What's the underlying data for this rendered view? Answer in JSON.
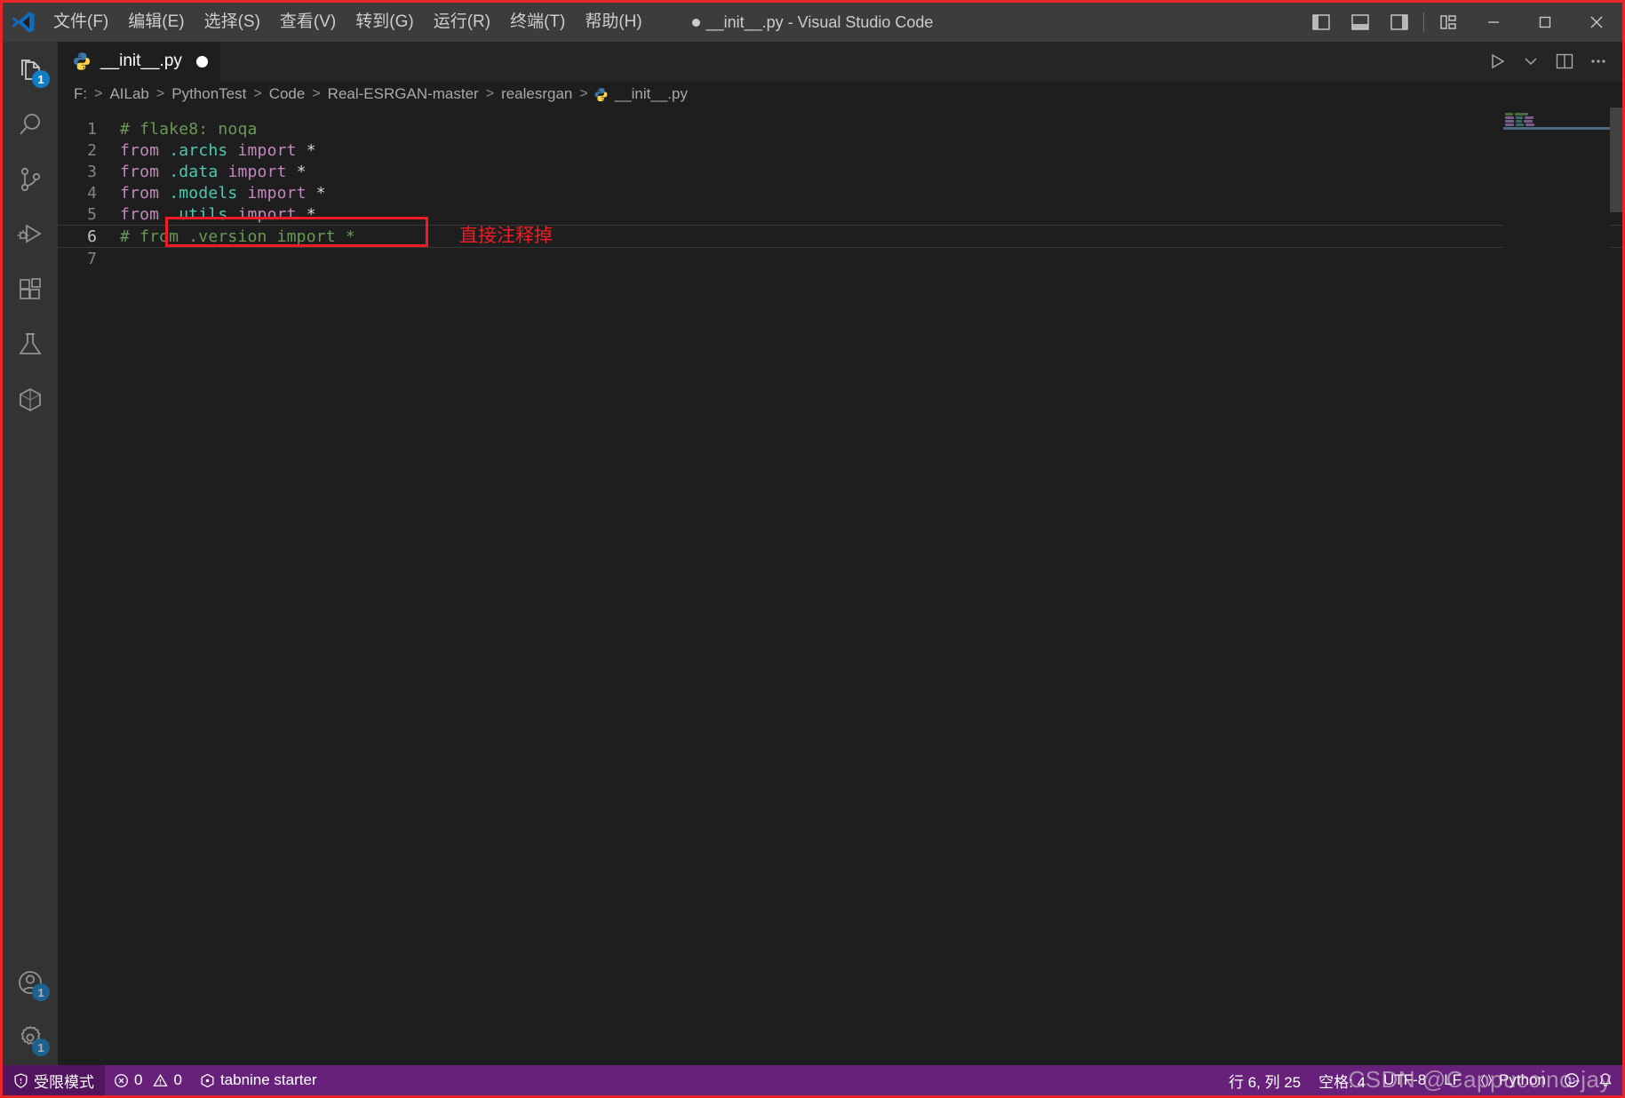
{
  "window": {
    "title": "__init__.py - Visual Studio Code",
    "dirty": true
  },
  "menu": {
    "items": [
      {
        "label": "文件(F)",
        "name": "menu-file"
      },
      {
        "label": "编辑(E)",
        "name": "menu-edit"
      },
      {
        "label": "选择(S)",
        "name": "menu-selection"
      },
      {
        "label": "查看(V)",
        "name": "menu-view"
      },
      {
        "label": "转到(G)",
        "name": "menu-go"
      },
      {
        "label": "运行(R)",
        "name": "menu-run"
      },
      {
        "label": "终端(T)",
        "name": "menu-terminal"
      },
      {
        "label": "帮助(H)",
        "name": "menu-help"
      }
    ]
  },
  "titlebar_controls": {
    "toggle_primary_sidebar": "toggle-primary-sidebar",
    "toggle_panel": "toggle-panel",
    "toggle_secondary_sidebar": "toggle-secondary-sidebar",
    "customize_layout": "customize-layout",
    "minimize": "−",
    "maximize": "□",
    "close": "✕"
  },
  "activitybar": {
    "items": [
      {
        "name": "explorer",
        "badge": "1"
      },
      {
        "name": "search",
        "badge": ""
      },
      {
        "name": "source-control",
        "badge": ""
      },
      {
        "name": "run-and-debug",
        "badge": ""
      },
      {
        "name": "extensions",
        "badge": ""
      },
      {
        "name": "testing",
        "badge": ""
      },
      {
        "name": "container-view",
        "badge": ""
      }
    ],
    "bottom": [
      {
        "name": "accounts",
        "badge": "1"
      },
      {
        "name": "manage-settings",
        "badge": "1"
      }
    ]
  },
  "tabs": [
    {
      "label": "__init__.py",
      "icon": "python-icon",
      "dirty": true,
      "active": true
    }
  ],
  "editor_actions": {
    "run": "run-python-file",
    "run_dropdown": "run-options",
    "split": "split-editor-right",
    "more": "more-actions"
  },
  "breadcrumb": {
    "items": [
      "F:",
      "AILab",
      "PythonTest",
      "Code",
      "Real-ESRGAN-master",
      "realesrgan",
      "__init__.py"
    ],
    "separator": ">"
  },
  "code": {
    "lines": [
      {
        "num": "1",
        "tokens": [
          {
            "t": "# flake8: noqa",
            "c": "tok-comment"
          }
        ]
      },
      {
        "num": "2",
        "tokens": [
          {
            "t": "from",
            "c": "tok-kw"
          },
          {
            "t": " ",
            "c": "tok-op"
          },
          {
            "t": ".archs",
            "c": "tok-mod"
          },
          {
            "t": " ",
            "c": "tok-op"
          },
          {
            "t": "import",
            "c": "tok-kw"
          },
          {
            "t": " *",
            "c": "tok-op"
          }
        ]
      },
      {
        "num": "3",
        "tokens": [
          {
            "t": "from",
            "c": "tok-kw"
          },
          {
            "t": " ",
            "c": "tok-op"
          },
          {
            "t": ".data",
            "c": "tok-mod"
          },
          {
            "t": " ",
            "c": "tok-op"
          },
          {
            "t": "import",
            "c": "tok-kw"
          },
          {
            "t": " *",
            "c": "tok-op"
          }
        ]
      },
      {
        "num": "4",
        "tokens": [
          {
            "t": "from",
            "c": "tok-kw"
          },
          {
            "t": " ",
            "c": "tok-op"
          },
          {
            "t": ".models",
            "c": "tok-mod"
          },
          {
            "t": " ",
            "c": "tok-op"
          },
          {
            "t": "import",
            "c": "tok-kw"
          },
          {
            "t": " *",
            "c": "tok-op"
          }
        ]
      },
      {
        "num": "5",
        "tokens": [
          {
            "t": "from",
            "c": "tok-kw"
          },
          {
            "t": " ",
            "c": "tok-op"
          },
          {
            "t": ".utils",
            "c": "tok-mod"
          },
          {
            "t": " ",
            "c": "tok-op"
          },
          {
            "t": "import",
            "c": "tok-kw"
          },
          {
            "t": " *",
            "c": "tok-op"
          }
        ]
      },
      {
        "num": "6",
        "current": true,
        "tokens": [
          {
            "t": "# from .version import *",
            "c": "tok-comment"
          }
        ]
      },
      {
        "num": "7",
        "tokens": []
      }
    ]
  },
  "annotation": {
    "text": "直接注释掉",
    "color": "#ee1c25"
  },
  "statusbar": {
    "restricted_mode": "受限模式",
    "errors": "0",
    "warnings": "0",
    "tabnine": "tabnine starter",
    "cursor": "行 6, 列 25",
    "indent": "空格: 4",
    "encoding": "UTF-8",
    "eol": "LF",
    "language": "Python",
    "feedback": "feedback-smiley",
    "bell": "notifications"
  },
  "watermark": {
    "text": "CSDN @Cappuccino-jay"
  },
  "colors": {
    "titlebar": "#3c3c3c",
    "activitybar": "#333333",
    "editor": "#1e1e1e",
    "statusbar": "#68217a",
    "accent_red": "#ee1c25",
    "badge_blue": "#0e7ec8"
  }
}
